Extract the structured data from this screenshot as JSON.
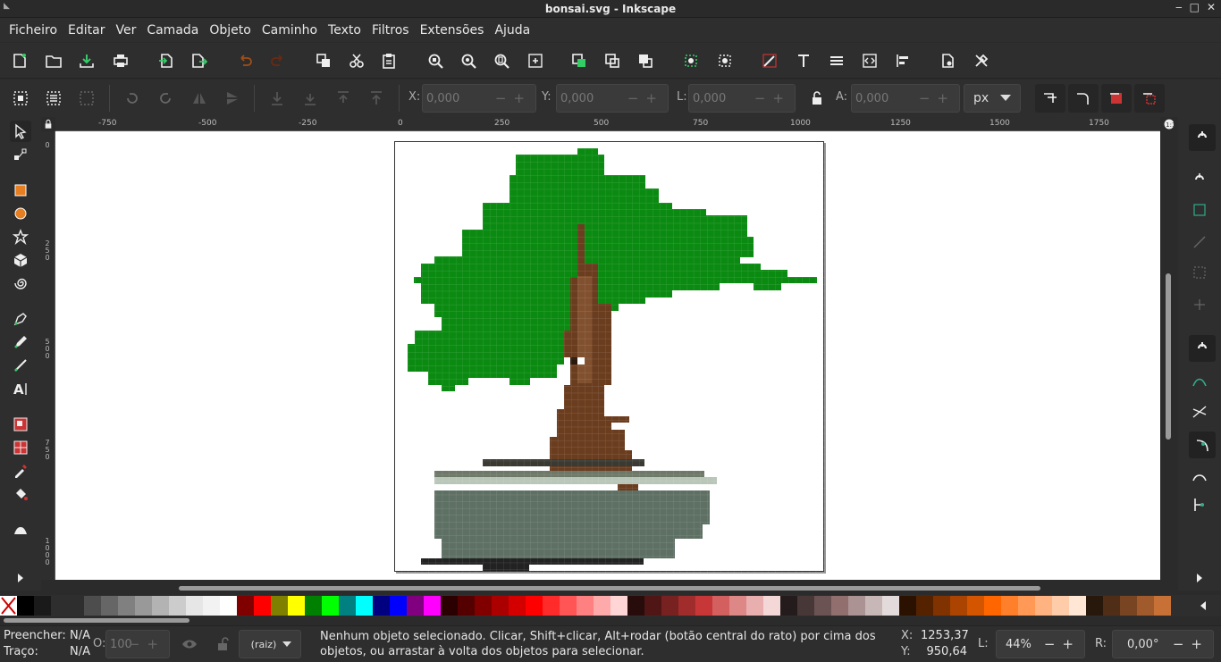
{
  "window": {
    "title": "bonsai.svg - Inkscape"
  },
  "menu": [
    "Ficheiro",
    "Editar",
    "Ver",
    "Camada",
    "Objeto",
    "Caminho",
    "Texto",
    "Filtros",
    "Extensões",
    "Ajuda"
  ],
  "toolbar_icons": [
    "new-document",
    "open-document",
    "save-document",
    "print",
    "import",
    "export",
    "undo",
    "redo",
    "duplicate",
    "cut",
    "paste",
    "zoom-selection",
    "zoom-drawing",
    "zoom-page",
    "zoom-fit",
    "group",
    "ungroup",
    "raise",
    "align",
    "snap-nodes",
    "edit-path",
    "text-tool",
    "layers",
    "xml-editor",
    "align-distribute",
    "document-properties",
    "preferences"
  ],
  "transform": {
    "x_label": "X:",
    "x_value": "0,000",
    "y_label": "Y:",
    "y_value": "0,000",
    "w_label": "L:",
    "w_value": "0,000",
    "h_label": "A:",
    "h_value": "0,000",
    "unit": "px"
  },
  "ruler_h_ticks": [
    "-750",
    "-500",
    "-250",
    "0",
    "250",
    "500",
    "750",
    "1000",
    "1250",
    "1500",
    "1750"
  ],
  "ruler_v_ticks": [
    "0",
    "250",
    "500",
    "750",
    "1000"
  ],
  "status": {
    "fill_label": "Preencher:",
    "fill_value": "N/A",
    "stroke_label": "Traço:",
    "stroke_value": "N/A",
    "opacity_label": "O:",
    "opacity_value": "100",
    "layer": "(raiz)",
    "message": "Nenhum objeto selecionado. Clicar, Shift+clicar, Alt+rodar (botão central do rato) por cima dos objetos, ou arrastar à volta dos objetos para selecionar.",
    "cursor_x_label": "X:",
    "cursor_x": "1253,37",
    "cursor_y_label": "Y:",
    "cursor_y": "950,64",
    "zoom_label": "L:",
    "zoom": "44%",
    "rotation_label": "R:",
    "rotation": "0,00°"
  },
  "palette": [
    "#000000",
    "#1a1a1a",
    "#2e2e2e",
    "#4d4d4d",
    "#666666",
    "#808080",
    "#999999",
    "#b3b3b3",
    "#cccccc",
    "#e6e6e6",
    "#f2f2f2",
    "#ffffff",
    "#800000",
    "#ff0000",
    "#808000",
    "#ffff00",
    "#008000",
    "#00ff00",
    "#008080",
    "#00ffff",
    "#000080",
    "#0000ff",
    "#800080",
    "#ff00ff",
    "#2b0000",
    "#550000",
    "#800000",
    "#aa0000",
    "#d40000",
    "#ff0000",
    "#ff2a2a",
    "#ff5555",
    "#ff8080",
    "#ffaaaa",
    "#ffd5d5",
    "#280b0b",
    "#501616",
    "#782121",
    "#a02c2c",
    "#c83737",
    "#d35f5f",
    "#de8787",
    "#e9afaf",
    "#f4d7d7",
    "#241c1c",
    "#483737",
    "#6c5353",
    "#916f6f",
    "#ac9393",
    "#c8b7b7",
    "#e3dbdb",
    "#2b1100",
    "#552200",
    "#803300",
    "#aa4400",
    "#d45500",
    "#ff6600",
    "#ff7f2a",
    "#ff9955",
    "#ffb380",
    "#ffccaa",
    "#ffe6d5",
    "#28170b",
    "#502d16",
    "#784421",
    "#a05a2c",
    "#c87137"
  ],
  "colors": {
    "bg": "#2e2e2e",
    "leaf": "#0b8a12",
    "trunk": "#6b3d1f",
    "pot": "#5e7064"
  }
}
